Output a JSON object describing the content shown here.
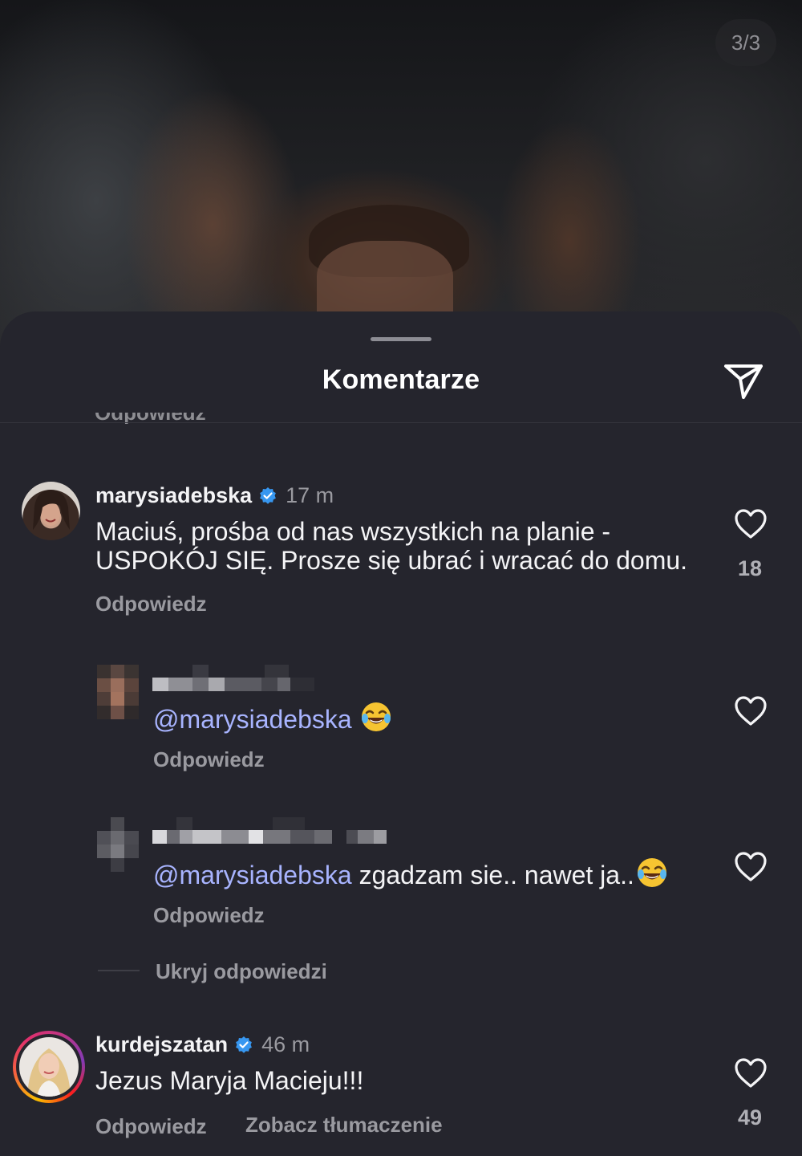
{
  "post": {
    "slide_counter": "3/3"
  },
  "sheet": {
    "title": "Komentarze",
    "cut_off_text": "Odpowiedz"
  },
  "comments": [
    {
      "username": "marysiadebska",
      "time": "17 m",
      "text_line1": "Maciuś, prośba od nas wszystkich na planie -",
      "text_line2": "USPOKÓJ SIĘ. Prosze się ubrać i wracać do domu.",
      "reply": "Odpowiedz",
      "likes": "18"
    },
    {
      "mention": "@marysiadebska",
      "text": "",
      "emoji": "face-with-tears-of-joy",
      "reply": "Odpowiedz"
    },
    {
      "mention": "@marysiadebska",
      "text": " zgadzam sie.. nawet ja..",
      "emoji": "face-with-tears-of-joy",
      "reply": "Odpowiedz"
    },
    {
      "username": "kurdejszatan",
      "time": "46 m",
      "text": "Jezus Maryja Macieju!!!",
      "reply": "Odpowiedz",
      "translate": "Zobacz tłumaczenie",
      "likes": "49"
    }
  ],
  "thread": {
    "hide_replies": "Ukryj odpowiedzi"
  },
  "colors": {
    "background": "#25252d",
    "mention": "#a8b4ff",
    "verified": "#3797f0",
    "muted": "#9a9aa0"
  }
}
